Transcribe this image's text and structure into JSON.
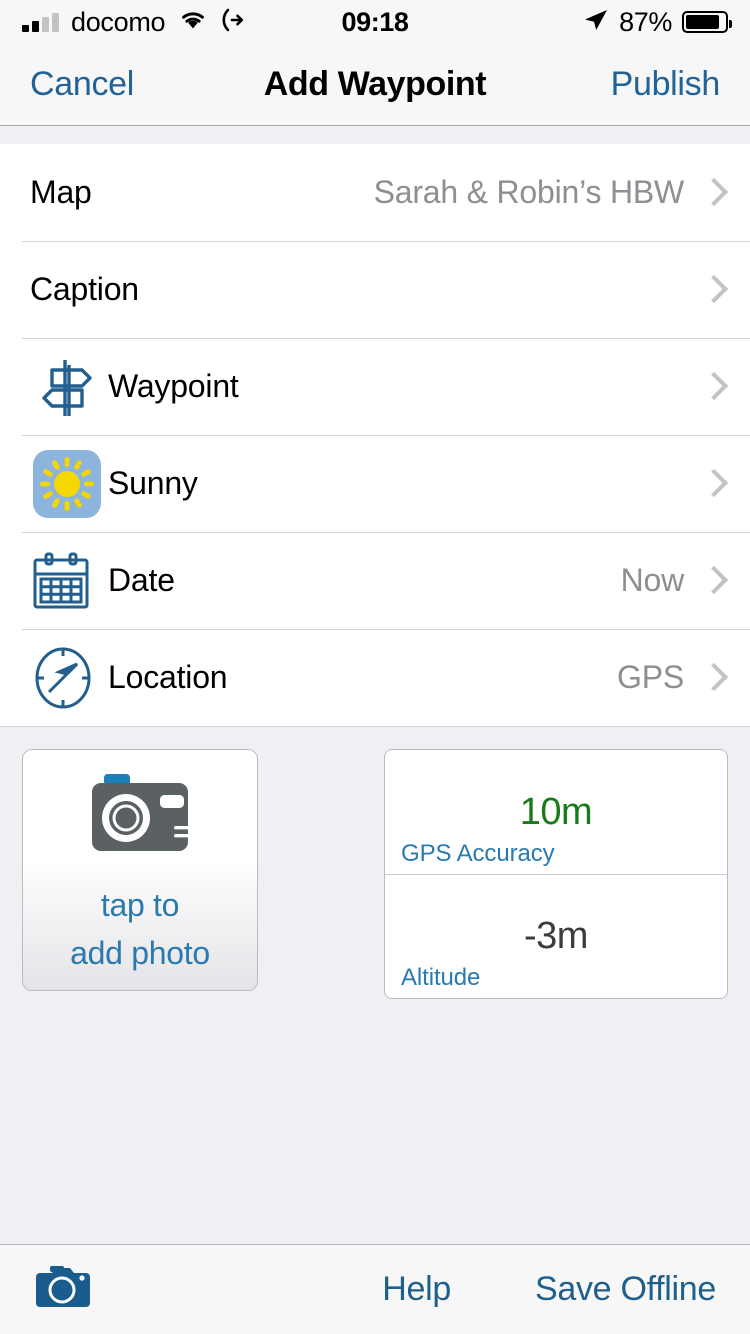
{
  "status_bar": {
    "carrier": "docomo",
    "time": "09:18",
    "battery_percent": "87%",
    "signal_bars_filled": 2,
    "signal_bars_total": 4,
    "icons": [
      "signal-bars-icon",
      "wifi-icon",
      "call-forwarding-icon",
      "location-arrow-icon",
      "battery-icon"
    ]
  },
  "navbar": {
    "cancel_label": "Cancel",
    "title": "Add Waypoint",
    "publish_label": "Publish"
  },
  "form_rows": [
    {
      "label": "Map",
      "value": "Sarah & Robin’s HBW",
      "icon": null
    },
    {
      "label": "Caption",
      "value": "",
      "icon": null
    },
    {
      "label": "Waypoint",
      "value": "",
      "icon": "signpost-icon"
    },
    {
      "label": "Sunny",
      "value": "",
      "icon": "sun-weather-icon"
    },
    {
      "label": "Date",
      "value": "Now",
      "icon": "calendar-icon"
    },
    {
      "label": "Location",
      "value": "GPS",
      "icon": "compass-icon"
    }
  ],
  "photo_button": {
    "line1": "tap to",
    "line2": "add photo",
    "icon": "camera-icon"
  },
  "gps_panel": {
    "accuracy_value": "10m",
    "accuracy_caption": "GPS Accuracy",
    "altitude_value": "-3m",
    "altitude_caption": "Altitude"
  },
  "toolbar": {
    "camera_icon": "camera-icon",
    "help_label": "Help",
    "save_offline_label": "Save Offline"
  },
  "colors": {
    "tint_blue": "#216297",
    "link_blue": "#2a7ab0",
    "accuracy_green": "#1a7a1a",
    "value_gray": "#8e8e93",
    "group_background": "#efeff4",
    "icon_blue": "#225f8f",
    "weather_tile": "#8cb4dc",
    "sun_yellow": "#f5d800"
  }
}
